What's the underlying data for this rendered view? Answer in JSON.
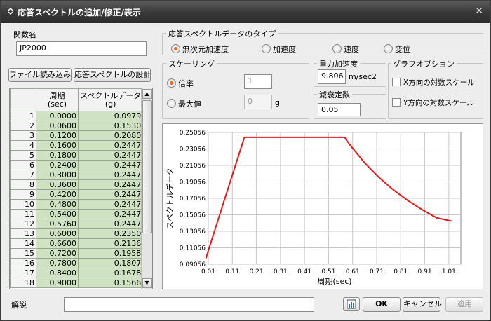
{
  "window": {
    "title": "応答スペクトルの追加/修正/表示"
  },
  "name_field": {
    "label": "関数名",
    "value": "JP2000"
  },
  "buttons": {
    "load_file": "ファイル読み込み",
    "design_spectrum": "応答スペクトルの設計",
    "ok": "OK",
    "cancel": "キャンセル",
    "apply": "適用"
  },
  "table": {
    "col_index": "",
    "col_period": "周期\n(sec)",
    "col_spectrum": "スペクトルデータ\n(g)",
    "rows": [
      [
        "1",
        "0.0000",
        "0.0979"
      ],
      [
        "2",
        "0.0600",
        "0.1530"
      ],
      [
        "3",
        "0.1200",
        "0.2080"
      ],
      [
        "4",
        "0.1600",
        "0.2447"
      ],
      [
        "5",
        "0.1800",
        "0.2447"
      ],
      [
        "6",
        "0.2400",
        "0.2447"
      ],
      [
        "7",
        "0.3000",
        "0.2447"
      ],
      [
        "8",
        "0.3600",
        "0.2447"
      ],
      [
        "9",
        "0.4200",
        "0.2447"
      ],
      [
        "10",
        "0.4800",
        "0.2447"
      ],
      [
        "11",
        "0.5400",
        "0.2447"
      ],
      [
        "12",
        "0.5760",
        "0.2447"
      ],
      [
        "13",
        "0.6000",
        "0.2350"
      ],
      [
        "14",
        "0.6600",
        "0.2136"
      ],
      [
        "15",
        "0.7200",
        "0.1958"
      ],
      [
        "16",
        "0.7800",
        "0.1807"
      ],
      [
        "17",
        "0.8400",
        "0.1678"
      ],
      [
        "18",
        "0.9000",
        "0.1566"
      ]
    ]
  },
  "spectrum_type": {
    "title": "応答スペクトルデータのタイプ",
    "options": [
      "無次元加速度",
      "加速度",
      "速度",
      "変位"
    ],
    "selected": 0
  },
  "scaling": {
    "title": "スケーリング",
    "factor_label": "倍率",
    "factor_value": "1",
    "max_label": "最大値",
    "max_value": "0",
    "max_unit": "g"
  },
  "gravity": {
    "title": "重力加速度",
    "value": "9.806",
    "unit": "m/sec2"
  },
  "damping": {
    "title": "減衰定数",
    "value": "0.05"
  },
  "graph_options": {
    "title": "グラフオプション",
    "x_log": "X方向の対数スケール",
    "y_log": "Y方向の対数スケール"
  },
  "description": {
    "label": "解説",
    "value": ""
  },
  "chart_data": {
    "type": "line",
    "xlabel": "周期(sec)",
    "ylabel": "スペクトルデータ",
    "xlim": [
      0.01,
      1.06
    ],
    "ylim": [
      0.09056,
      0.25056
    ],
    "x_ticks": [
      "0.01",
      "0.11",
      "0.21",
      "0.31",
      "0.41",
      "0.51",
      "0.61",
      "0.71",
      "0.81",
      "0.91",
      "1.01"
    ],
    "y_ticks": [
      "0.09056",
      "0.11056",
      "0.13056",
      "0.15056",
      "0.17056",
      "0.19056",
      "0.21056",
      "0.23056",
      "0.25056"
    ],
    "grid": true,
    "line_color": "#e41a1c",
    "series": [
      {
        "x": [
          0.0,
          0.06,
          0.12,
          0.16,
          0.18,
          0.24,
          0.3,
          0.36,
          0.42,
          0.48,
          0.54,
          0.576,
          0.6,
          0.66,
          0.72,
          0.78,
          0.84,
          0.9,
          0.96,
          1.02
        ],
        "y": [
          0.0979,
          0.153,
          0.208,
          0.2447,
          0.2447,
          0.2447,
          0.2447,
          0.2447,
          0.2447,
          0.2447,
          0.2447,
          0.2447,
          0.235,
          0.2136,
          0.1958,
          0.1807,
          0.1678,
          0.1566,
          0.1468,
          0.143
        ]
      }
    ]
  }
}
